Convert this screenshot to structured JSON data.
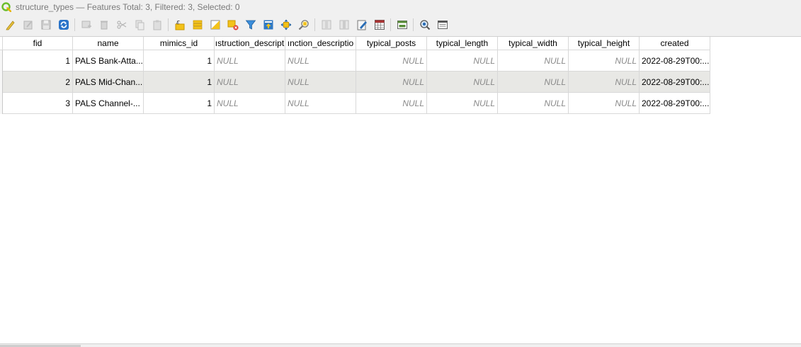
{
  "window": {
    "title": "structure_types — Features Total: 3, Filtered: 3, Selected: 0"
  },
  "toolbar": {
    "icons": [
      "toggle-editing-icon",
      "multi-edit-icon",
      "save-edits-icon",
      "reload-icon",
      "add-feature-icon",
      "delete-feature-icon",
      "cut-icon",
      "copy-icon",
      "paste-icon",
      "select-by-expression-icon",
      "select-all-icon",
      "invert-selection-icon",
      "deselect-all-icon",
      "filter-icon",
      "move-selection-to-top-icon",
      "pan-to-selection-icon",
      "zoom-to-selection-icon",
      "new-field-icon",
      "delete-field-icon",
      "open-field-calculator-icon",
      "conditional-formatting-icon",
      "dock-table-icon",
      "search-actions-icon",
      "form-view-icon"
    ]
  },
  "table": {
    "columns": [
      {
        "key": "fid",
        "label": "fid"
      },
      {
        "key": "name",
        "label": "name"
      },
      {
        "key": "mimics_id",
        "label": "mimics_id"
      },
      {
        "key": "construction_description",
        "label": "ıstruction_descript"
      },
      {
        "key": "function_description",
        "label": "ınction_descriptio"
      },
      {
        "key": "typical_posts",
        "label": "typical_posts"
      },
      {
        "key": "typical_length",
        "label": "typical_length"
      },
      {
        "key": "typical_width",
        "label": "typical_width"
      },
      {
        "key": "typical_height",
        "label": "typical_height"
      },
      {
        "key": "created",
        "label": "created"
      }
    ],
    "rows": [
      {
        "fid": "1",
        "name": "PALS Bank-Atta...",
        "mimics_id": "1",
        "construction_description": "NULL",
        "function_description": "NULL",
        "typical_posts": "NULL",
        "typical_length": "NULL",
        "typical_width": "NULL",
        "typical_height": "NULL",
        "created": "2022-08-29T00:..."
      },
      {
        "fid": "2",
        "name": "PALS Mid-Chan...",
        "mimics_id": "1",
        "construction_description": "NULL",
        "function_description": "NULL",
        "typical_posts": "NULL",
        "typical_length": "NULL",
        "typical_width": "NULL",
        "typical_height": "NULL",
        "created": "2022-08-29T00:..."
      },
      {
        "fid": "3",
        "name": "PALS Channel-...",
        "mimics_id": "1",
        "construction_description": "NULL",
        "function_description": "NULL",
        "typical_posts": "NULL",
        "typical_length": "NULL",
        "typical_width": "NULL",
        "typical_height": "NULL",
        "created": "2022-08-29T00:..."
      }
    ]
  },
  "colors": {
    "qgis_green": "#6bbd2b",
    "alt_row": "#e8e8e5",
    "null_text": "#8a8a8a"
  }
}
